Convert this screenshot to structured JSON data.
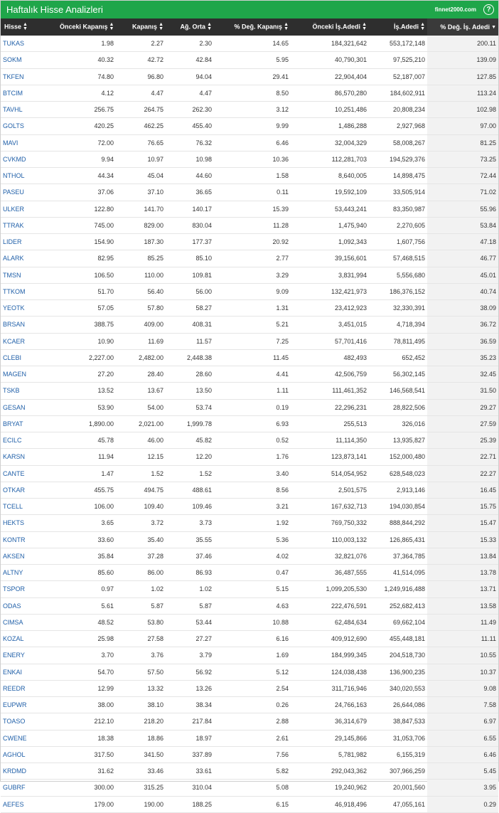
{
  "title": "Haftalık Hisse Analizleri",
  "brand": "finnet2000.com",
  "help": "?",
  "colors": {
    "header_bar": "#1fa64a",
    "table_header": "#2e2e2e",
    "link": "#1f5fa8",
    "sorted_column": "#f2f2f2"
  },
  "icons": {
    "sort": "sort-updown-icon",
    "sort_active": "sort-down-icon",
    "help": "help-icon"
  },
  "columns": [
    "Hisse",
    "Önceki Kapanış",
    "Kapanış",
    "Ağ. Orta",
    "% Değ. Kapanış",
    "Önceki İş.Adedi",
    "İş.Adedi",
    "% Değ. İş. Adedi"
  ],
  "rows": [
    [
      "TUKAS",
      "1.98",
      "2.27",
      "2.30",
      "14.65",
      "184,321,642",
      "553,172,148",
      "200.11"
    ],
    [
      "SOKM",
      "40.32",
      "42.72",
      "42.84",
      "5.95",
      "40,790,301",
      "97,525,210",
      "139.09"
    ],
    [
      "TKFEN",
      "74.80",
      "96.80",
      "94.04",
      "29.41",
      "22,904,404",
      "52,187,007",
      "127.85"
    ],
    [
      "BTCIM",
      "4.12",
      "4.47",
      "4.47",
      "8.50",
      "86,570,280",
      "184,602,911",
      "113.24"
    ],
    [
      "TAVHL",
      "256.75",
      "264.75",
      "262.30",
      "3.12",
      "10,251,486",
      "20,808,234",
      "102.98"
    ],
    [
      "GOLTS",
      "420.25",
      "462.25",
      "455.40",
      "9.99",
      "1,486,288",
      "2,927,968",
      "97.00"
    ],
    [
      "MAVI",
      "72.00",
      "76.65",
      "76.32",
      "6.46",
      "32,004,329",
      "58,008,267",
      "81.25"
    ],
    [
      "CVKMD",
      "9.94",
      "10.97",
      "10.98",
      "10.36",
      "112,281,703",
      "194,529,376",
      "73.25"
    ],
    [
      "NTHOL",
      "44.34",
      "45.04",
      "44.60",
      "1.58",
      "8,640,005",
      "14,898,475",
      "72.44"
    ],
    [
      "PASEU",
      "37.06",
      "37.10",
      "36.65",
      "0.11",
      "19,592,109",
      "33,505,914",
      "71.02"
    ],
    [
      "ULKER",
      "122.80",
      "141.70",
      "140.17",
      "15.39",
      "53,443,241",
      "83,350,987",
      "55.96"
    ],
    [
      "TTRAK",
      "745.00",
      "829.00",
      "830.04",
      "11.28",
      "1,475,940",
      "2,270,605",
      "53.84"
    ],
    [
      "LIDER",
      "154.90",
      "187.30",
      "177.37",
      "20.92",
      "1,092,343",
      "1,607,756",
      "47.18"
    ],
    [
      "ALARK",
      "82.95",
      "85.25",
      "85.10",
      "2.77",
      "39,156,601",
      "57,468,515",
      "46.77"
    ],
    [
      "TMSN",
      "106.50",
      "110.00",
      "109.81",
      "3.29",
      "3,831,994",
      "5,556,680",
      "45.01"
    ],
    [
      "TTKOM",
      "51.70",
      "56.40",
      "56.00",
      "9.09",
      "132,421,973",
      "186,376,152",
      "40.74"
    ],
    [
      "YEOTK",
      "57.05",
      "57.80",
      "58.27",
      "1.31",
      "23,412,923",
      "32,330,391",
      "38.09"
    ],
    [
      "BRSAN",
      "388.75",
      "409.00",
      "408.31",
      "5.21",
      "3,451,015",
      "4,718,394",
      "36.72"
    ],
    [
      "KCAER",
      "10.90",
      "11.69",
      "11.57",
      "7.25",
      "57,701,416",
      "78,811,495",
      "36.59"
    ],
    [
      "CLEBI",
      "2,227.00",
      "2,482.00",
      "2,448.38",
      "11.45",
      "482,493",
      "652,452",
      "35.23"
    ],
    [
      "MAGEN",
      "27.20",
      "28.40",
      "28.60",
      "4.41",
      "42,506,759",
      "56,302,145",
      "32.45"
    ],
    [
      "TSKB",
      "13.52",
      "13.67",
      "13.50",
      "1.11",
      "111,461,352",
      "146,568,541",
      "31.50"
    ],
    [
      "GESAN",
      "53.90",
      "54.00",
      "53.74",
      "0.19",
      "22,296,231",
      "28,822,506",
      "29.27"
    ],
    [
      "BRYAT",
      "1,890.00",
      "2,021.00",
      "1,999.78",
      "6.93",
      "255,513",
      "326,016",
      "27.59"
    ],
    [
      "ECILC",
      "45.78",
      "46.00",
      "45.82",
      "0.52",
      "11,114,350",
      "13,935,827",
      "25.39"
    ],
    [
      "KARSN",
      "11.94",
      "12.15",
      "12.20",
      "1.76",
      "123,873,141",
      "152,000,480",
      "22.71"
    ],
    [
      "CANTE",
      "1.47",
      "1.52",
      "1.52",
      "3.40",
      "514,054,952",
      "628,548,023",
      "22.27"
    ],
    [
      "OTKAR",
      "455.75",
      "494.75",
      "488.61",
      "8.56",
      "2,501,575",
      "2,913,146",
      "16.45"
    ],
    [
      "TCELL",
      "106.00",
      "109.40",
      "109.46",
      "3.21",
      "167,632,713",
      "194,030,854",
      "15.75"
    ],
    [
      "HEKTS",
      "3.65",
      "3.72",
      "3.73",
      "1.92",
      "769,750,332",
      "888,844,292",
      "15.47"
    ],
    [
      "KONTR",
      "33.60",
      "35.40",
      "35.55",
      "5.36",
      "110,003,132",
      "126,865,431",
      "15.33"
    ],
    [
      "AKSEN",
      "35.84",
      "37.28",
      "37.46",
      "4.02",
      "32,821,076",
      "37,364,785",
      "13.84"
    ],
    [
      "ALTNY",
      "85.60",
      "86.00",
      "86.93",
      "0.47",
      "36,487,555",
      "41,514,095",
      "13.78"
    ],
    [
      "TSPOR",
      "0.97",
      "1.02",
      "1.02",
      "5.15",
      "1,099,205,530",
      "1,249,916,488",
      "13.71"
    ],
    [
      "ODAS",
      "5.61",
      "5.87",
      "5.87",
      "4.63",
      "222,476,591",
      "252,682,413",
      "13.58"
    ],
    [
      "CIMSA",
      "48.52",
      "53.80",
      "53.44",
      "10.88",
      "62,484,634",
      "69,662,104",
      "11.49"
    ],
    [
      "KOZAL",
      "25.98",
      "27.58",
      "27.27",
      "6.16",
      "409,912,690",
      "455,448,181",
      "11.11"
    ],
    [
      "ENERY",
      "3.70",
      "3.76",
      "3.79",
      "1.69",
      "184,999,345",
      "204,518,730",
      "10.55"
    ],
    [
      "ENKAI",
      "54.70",
      "57.50",
      "56.92",
      "5.12",
      "124,038,438",
      "136,900,235",
      "10.37"
    ],
    [
      "REEDR",
      "12.99",
      "13.32",
      "13.26",
      "2.54",
      "311,716,946",
      "340,020,553",
      "9.08"
    ],
    [
      "EUPWR",
      "38.00",
      "38.10",
      "38.34",
      "0.26",
      "24,766,163",
      "26,644,086",
      "7.58"
    ],
    [
      "TOASO",
      "212.10",
      "218.20",
      "217.84",
      "2.88",
      "36,314,679",
      "38,847,533",
      "6.97"
    ],
    [
      "CWENE",
      "18.38",
      "18.86",
      "18.97",
      "2.61",
      "29,145,866",
      "31,053,706",
      "6.55"
    ],
    [
      "AGHOL",
      "317.50",
      "341.50",
      "337.89",
      "7.56",
      "5,781,982",
      "6,155,319",
      "6.46"
    ],
    [
      "KRDMD",
      "31.62",
      "33.46",
      "33.61",
      "5.82",
      "292,043,362",
      "307,966,259",
      "5.45"
    ],
    [
      "GUBRF",
      "300.00",
      "315.25",
      "310.04",
      "5.08",
      "19,240,962",
      "20,001,560",
      "3.95"
    ],
    [
      "AEFES",
      "179.00",
      "190.00",
      "188.25",
      "6.15",
      "46,918,496",
      "47,055,161",
      "0.29"
    ]
  ]
}
